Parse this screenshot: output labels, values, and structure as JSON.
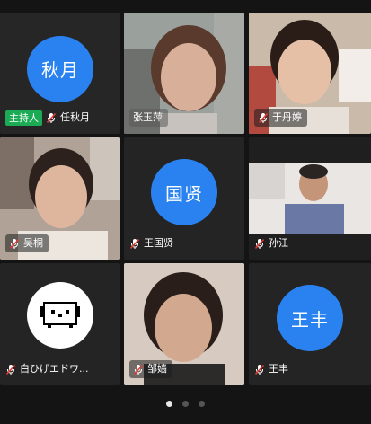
{
  "tiles": [
    {
      "name": "任秋月",
      "avatar_text": "秋月",
      "host_label": "主持人",
      "has_video": false
    },
    {
      "name": "张玉萍",
      "has_video": true
    },
    {
      "name": "于丹婷",
      "has_video": true
    },
    {
      "name": "吴桐",
      "has_video": true
    },
    {
      "name": "王国贤",
      "avatar_text": "国贤",
      "has_video": false
    },
    {
      "name": "孙江",
      "has_video": true
    },
    {
      "name": "白ひげエドワ...",
      "avatar_type": "image",
      "has_video": false
    },
    {
      "name": "邹嫱",
      "has_video": true
    },
    {
      "name": "王丰",
      "avatar_text": "王丰",
      "has_video": false
    }
  ],
  "pagination": {
    "total": 3,
    "current": 1
  },
  "colors": {
    "avatar_blue": "#2a82f0",
    "host_green": "#1bab55",
    "muted_red": "#e53935"
  }
}
